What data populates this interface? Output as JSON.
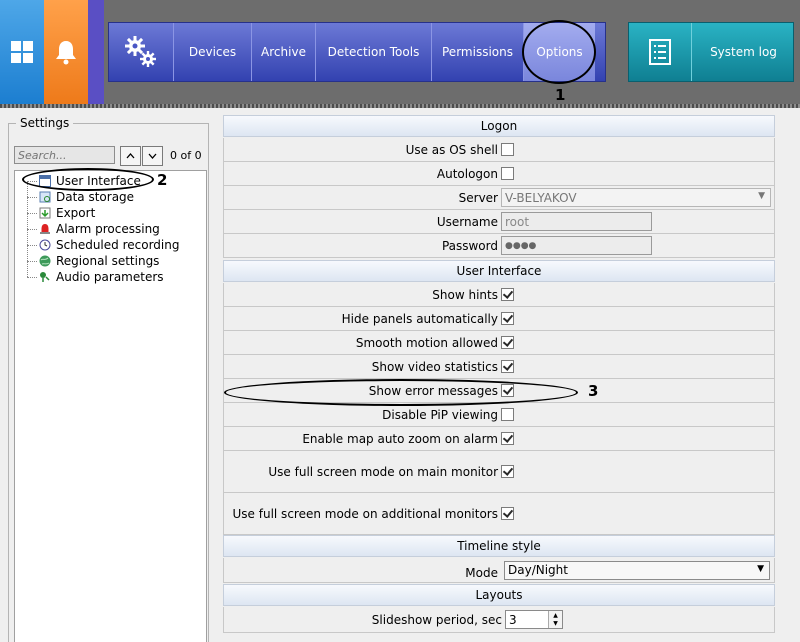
{
  "topbar": {
    "nav": [
      {
        "label": "",
        "icon": "gears-icon"
      },
      {
        "label": "Devices"
      },
      {
        "label": "Archive"
      },
      {
        "label": "Detection Tools"
      },
      {
        "label": "Permissions"
      },
      {
        "label": "Options"
      }
    ],
    "system_log": "System log",
    "colors": {
      "windows_tile": "#2f93e0",
      "bell_tile": "#f58b2c",
      "nav_group": "#4a56c4",
      "syslog_group": "#1a9aad"
    }
  },
  "annotations": {
    "a1": "1",
    "a2": "2",
    "a3": "3"
  },
  "settings": {
    "title": "Settings",
    "search_placeholder": "Search...",
    "match_count": "0 of 0",
    "tree": [
      {
        "label": "User Interface",
        "icon": "window-icon"
      },
      {
        "label": "Data storage",
        "icon": "database-icon"
      },
      {
        "label": "Export",
        "icon": "export-icon"
      },
      {
        "label": "Alarm processing",
        "icon": "alarm-icon"
      },
      {
        "label": "Scheduled recording",
        "icon": "clock-icon"
      },
      {
        "label": "Regional settings",
        "icon": "globe-icon"
      },
      {
        "label": "Audio parameters",
        "icon": "speaker-icon"
      }
    ]
  },
  "options": {
    "logon": {
      "title": "Logon",
      "use_os_shell": "Use as OS shell",
      "autologon": "Autologon",
      "server_label": "Server",
      "server_value": "V-BELYAKOV",
      "username_label": "Username",
      "username_value": "root",
      "password_label": "Password",
      "password_value": "●●●●"
    },
    "ui": {
      "title": "User Interface",
      "show_hints": "Show hints",
      "hide_panels": "Hide panels automatically",
      "smooth_motion": "Smooth motion allowed",
      "show_video_stats": "Show video statistics",
      "show_error_messages": "Show error messages",
      "disable_pip": "Disable PiP viewing",
      "map_auto_zoom": "Enable map auto zoom on alarm",
      "fullscreen_main": "Use full screen mode on main monitor",
      "fullscreen_additional": "Use full screen mode on additional monitors"
    },
    "timeline": {
      "title": "Timeline style",
      "mode_label": "Mode",
      "mode_value": "Day/Night"
    },
    "layouts": {
      "title": "Layouts",
      "slideshow_label": "Slideshow period, sec",
      "slideshow_value": "3"
    }
  }
}
